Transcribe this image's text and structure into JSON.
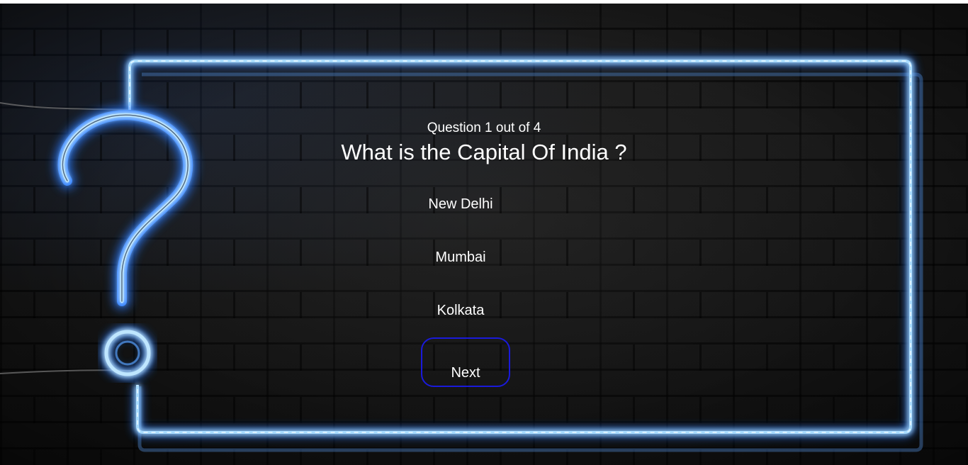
{
  "quiz": {
    "counter": "Question 1 out of 4",
    "question": "What is the Capital Of India ?",
    "options": [
      "New Delhi",
      "Mumbai",
      "Kolkata"
    ],
    "next_label": "Next"
  },
  "icons": {
    "decoration": "question-mark-icon"
  },
  "colors": {
    "neon": "#8fd3ff",
    "neon_glow": "#2a7bff",
    "button_border": "#1a1adb",
    "text": "#ffffff"
  }
}
